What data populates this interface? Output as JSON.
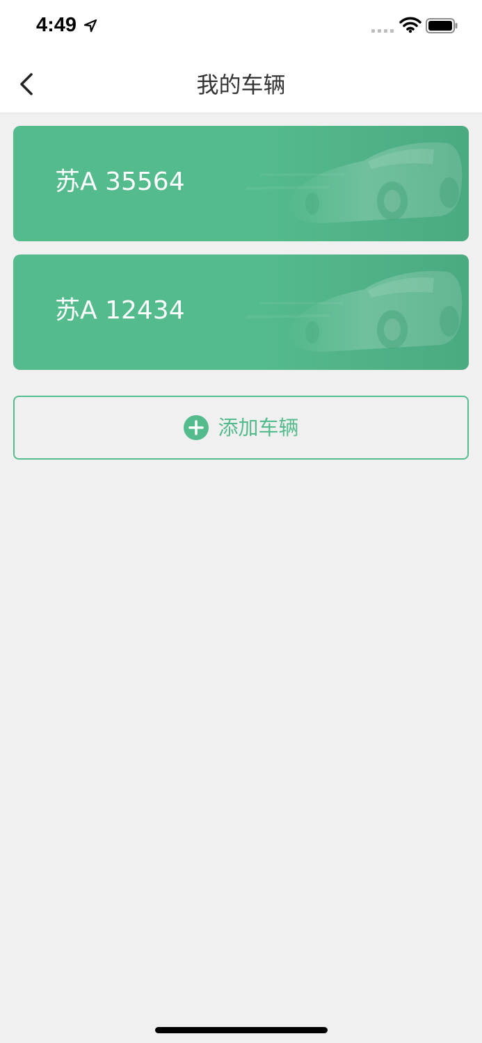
{
  "status_bar": {
    "time": "4:49",
    "icons": [
      "location-arrow-icon",
      "cellular-signal-icon",
      "wifi-icon",
      "battery-icon"
    ]
  },
  "nav": {
    "title": "我的车辆",
    "back_icon": "chevron-left-icon"
  },
  "vehicles": [
    {
      "plate": "苏A 35564"
    },
    {
      "plate": "苏A 12434"
    }
  ],
  "add_vehicle": {
    "label": "添加车辆",
    "icon": "plus-circle-icon"
  },
  "colors": {
    "accent": "#54bb8c",
    "background": "#f0f0f0",
    "title_text": "#333333"
  }
}
